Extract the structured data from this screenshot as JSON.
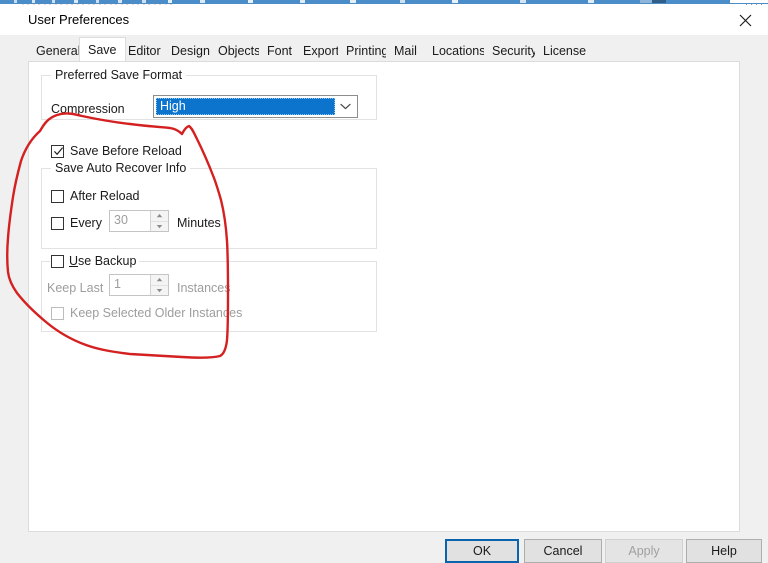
{
  "window": {
    "title": "User Preferences",
    "close_icon": "close-icon"
  },
  "tabs": [
    {
      "label": "General",
      "selected": false
    },
    {
      "label": "Save",
      "selected": true
    },
    {
      "label": "Editor",
      "selected": false
    },
    {
      "label": "Design",
      "selected": false
    },
    {
      "label": "Objects",
      "selected": false
    },
    {
      "label": "Font",
      "selected": false
    },
    {
      "label": "Export",
      "selected": false
    },
    {
      "label": "Printing",
      "selected": false
    },
    {
      "label": "Mail",
      "selected": false
    },
    {
      "label": "Locations",
      "selected": false
    },
    {
      "label": "Security",
      "selected": false
    },
    {
      "label": "License",
      "selected": false
    }
  ],
  "save_tab": {
    "preferred_save_format": {
      "legend": "Preferred Save Format",
      "compression_label": "Compression",
      "compression_value": "High",
      "compression_options": [
        "High"
      ],
      "dropdown_icon": "chevron-down-icon"
    },
    "save_before_reload": {
      "label": "Save Before Reload",
      "checked": true
    },
    "save_auto_recover": {
      "legend": "Save Auto Recover Info",
      "after_reload_label": "After Reload",
      "after_reload_checked": false,
      "every_label": "Every",
      "every_checked": false,
      "minutes_value": "30",
      "minutes_label": "Minutes",
      "minutes_disabled": true
    },
    "use_backup": {
      "legend": "Use Backup",
      "legend_accel": "U",
      "legend_rest": "se Backup",
      "checked": false,
      "keep_last_label": "Keep Last",
      "keep_last_value": "1",
      "instances_label": "Instances",
      "keep_last_disabled": true,
      "keep_selected_label": "Keep Selected Older Instances",
      "keep_selected_checked": false,
      "keep_selected_disabled": true
    }
  },
  "footer": {
    "ok": "OK",
    "cancel": "Cancel",
    "apply": "Apply",
    "help": "Help",
    "apply_disabled": true,
    "default_button": "OK"
  },
  "annotation": {
    "type": "freehand-ellipse",
    "color": "#d42020",
    "stroke_width": 2.4,
    "encircles": [
      "Save Before Reload",
      "Save Auto Recover Info",
      "Use Backup"
    ]
  },
  "colors": {
    "dialog_background": "#f0f0f0",
    "page_background": "#ffffff",
    "selection_blue": "#0c74cd",
    "default_button_border": "#0a64ad",
    "annotation_red": "#d42020",
    "disabled_text": "#9d9d9d",
    "group_border": "#e2e2e2",
    "titlebar_accent": "#4a8dc8"
  }
}
